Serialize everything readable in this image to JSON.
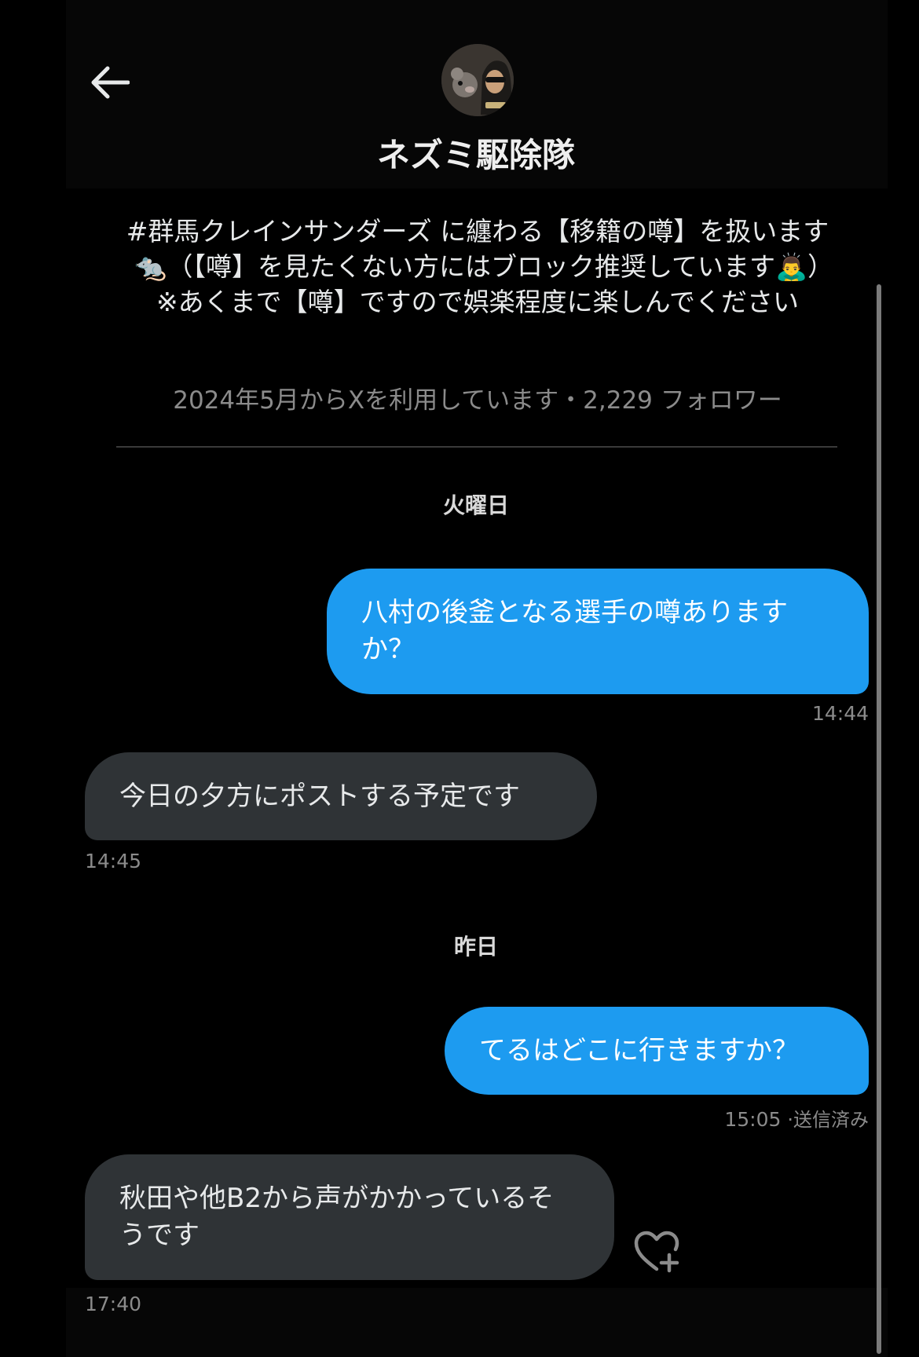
{
  "header": {
    "title": "ネズミ駆除隊",
    "back_icon": "arrow-left-icon",
    "avatar_alt": "ネズミ駆除隊"
  },
  "profile": {
    "bio": "#群馬クレインサンダーズ に纏わる【移籍の噂】を扱います🐀（【噂】を見たくない方にはブロック推奨しています🙇‍♂️）　　　　※あくまで【噂】ですので娯楽程度に楽しんでください",
    "meta": "2024年5月からXを利用しています・2,229 フォロワー"
  },
  "messages": {
    "day1": "火曜日",
    "m1": {
      "text": "八村の後釜となる選手の噂ありますか？",
      "time": "14:44"
    },
    "m2": {
      "text": "今日の夕方にポストする予定です",
      "time": "14:45"
    },
    "day2": "昨日",
    "m3": {
      "text": "てるはどこに行きますか？",
      "time": "15:05",
      "status": "·送信済み"
    },
    "m4": {
      "text": "秋田や他B2から声がかかっているそうです",
      "time": "17:40"
    }
  },
  "colors": {
    "sent_bubble": "#1d9bf0",
    "received_bubble": "#2f3336",
    "background": "#000000",
    "secondary_text": "#8b8b8b"
  },
  "icons": {
    "add_reaction": "heart-plus-icon"
  }
}
